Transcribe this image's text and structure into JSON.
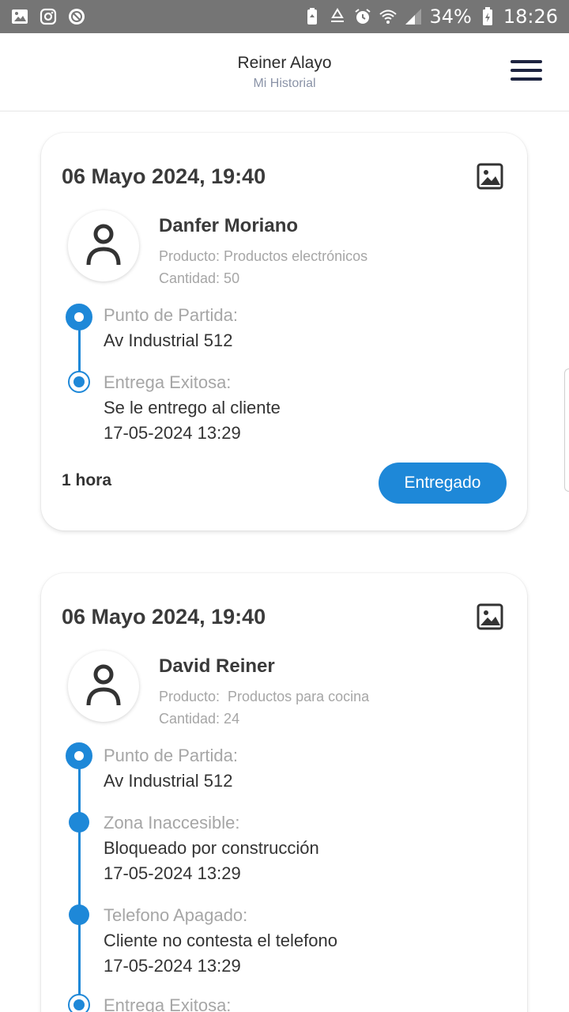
{
  "statusbar": {
    "left_icons": [
      "gallery-icon",
      "instagram-icon",
      "blocked-icon"
    ],
    "right_icons": [
      "battery-saver-icon",
      "recycle-icon",
      "alarm-icon",
      "wifi-icon",
      "signal-icon"
    ],
    "battery": "34%",
    "time": "18:26"
  },
  "header": {
    "title": "Reiner Alayo",
    "subtitle": "Mi Historial",
    "menu_icon": "hamburger-menu-icon"
  },
  "cards": [
    {
      "date": "06 Mayo 2024, 19:40",
      "name": "Danfer Moriano",
      "product": "Producto: Productos electrónicos",
      "quantity": "Cantidad: 50",
      "events": [
        {
          "label": "Punto de Partida:",
          "lines": [
            "Av Industrial 512"
          ]
        },
        {
          "label": "Entrega Exitosa:",
          "lines": [
            "Se le entrego al cliente",
            "17-05-2024 13:29"
          ]
        }
      ],
      "duration": "1 hora",
      "status": "Entregado"
    },
    {
      "date": "06 Mayo 2024, 19:40",
      "name": "David Reiner",
      "product": "Producto:  Productos para cocina",
      "quantity": "Cantidad: 24",
      "events": [
        {
          "label": "Punto de Partida:",
          "lines": [
            "Av Industrial 512"
          ]
        },
        {
          "label": "Zona Inaccesible:",
          "lines": [
            "Bloqueado por construcción",
            "17-05-2024 13:29"
          ]
        },
        {
          "label": "Telefono Apagado:",
          "lines": [
            "Cliente no contesta el telefono",
            "17-05-2024 13:29"
          ]
        },
        {
          "label": "Entrega Exitosa:",
          "lines": []
        }
      ]
    }
  ],
  "colors": {
    "accent": "#1e88d8",
    "statusbar": "#757575",
    "header_subtitle": "#8a93a7"
  }
}
